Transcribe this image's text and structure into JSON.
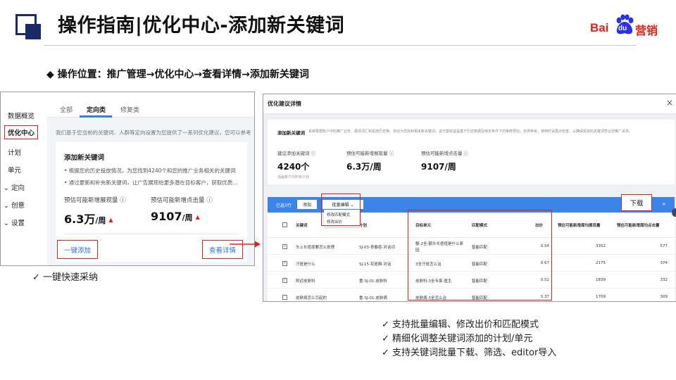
{
  "header": {
    "title": "操作指南|优化中心-添加新关键词",
    "logo": {
      "bai": "Bai",
      "du": "du",
      "yingxiao": "营销"
    }
  },
  "location_line": "◆ 操作位置：推广管理→优化中心→查看详情→添加新关键词",
  "left_panel": {
    "sidebar": [
      "数据概览",
      "优化中心",
      "计划",
      "单元",
      "定向",
      "创意",
      "设置"
    ],
    "sidebar_expand_glyph": "⌄",
    "tabs": [
      "全部",
      "定向类",
      "修复类"
    ],
    "description": "我们基于您当前的关键词、人群等定向设置为您提供了一系列优化建议，您可以参考",
    "card": {
      "title": "添加新关键词",
      "bullets": [
        "• 根据您的历史投放情况，为您找到4240个和您的推广业务相关的关键词",
        "• 通过更新和补充新关键词，让广告展现给更多潜在目标客户，获取优质..."
      ],
      "metric1_label": "预估可能新增展现量 ⓘ",
      "metric1_value": "6.3万",
      "metric1_unit": "/周",
      "metric2_label": "预估可能新增点击量 ⓘ",
      "metric2_value": "9107",
      "metric2_unit": "/周",
      "trend_glyph": "▲",
      "btn_one_click": "一键添加",
      "btn_details": "查看详情"
    }
  },
  "left_check": "✓ 一键快速采纳",
  "right_panel": {
    "title": "优化建议详情",
    "close_glyph": "×",
    "section1": {
      "title": "添加新关键词",
      "desc": "系统根据账户中的推广业务、展现词汇和投放历史等，自动为您找到相关新关键词。该方案收益是基于历史数据及特定条件下的推荐预估，仅供参考。使用时请再次检查，以确保投放的关键词符合您推广诉求。",
      "labels": [
        "建议添加关键词 ⓘ",
        "预估可能新增展现量 ⓘ",
        "预估可能新增点击量 ⓘ"
      ],
      "values": [
        "4240个",
        "6.3万/周",
        "9107/周"
      ],
      "note": "涵盖账户内所有计划"
    },
    "toolbar": {
      "selected": "已选3行",
      "add": "添加",
      "batch_edit": "批量编辑 ⌄",
      "dropdown": [
        "修改匹配模式",
        "修改出价"
      ],
      "download": "下载",
      "close_glyph": "×"
    },
    "columns": [
      "关键词",
      "计划",
      "目标单元",
      "匹配模式",
      "出价",
      "预估可能新增周均展现量",
      "预估可能新增周均点击量"
    ],
    "rows": [
      {
        "checked": true,
        "keyword": "头上长痘痘要怎么处理",
        "plan": "SJ-03-青春痘-对话词",
        "unit_line1": "额-2全-额头长痘痘是什么原",
        "unit_line2": "因",
        "match": "智能匹配",
        "bid": "0.54",
        "impr": "3352",
        "clicks": "577"
      },
      {
        "checked": true,
        "keyword": "汗斑是什么",
        "plan": "SJ-15-花斑癣-对话",
        "unit_line1": "3全汗斑怎么治",
        "unit_line2": "",
        "match": "智能匹配",
        "bid": "0.67",
        "impr": "2175",
        "clicks": "374"
      },
      {
        "checked": true,
        "keyword": "附近皮肤科",
        "plan": "重-SJ-01-皮肤科",
        "unit_line1": "皮肤科-3全专家-医生",
        "unit_line2": "",
        "match": "智能匹配",
        "bid": "0.52",
        "impr": "1839",
        "clicks": "332"
      },
      {
        "checked": false,
        "keyword": "皮肤病怎么引起的",
        "plan": "重-SJ-01-皮肤病",
        "unit_line1": "皮肤病-3全怎么治",
        "unit_line2": "",
        "match": "智能匹配",
        "bid": "0.37",
        "impr": "1709",
        "clicks": "309"
      }
    ]
  },
  "right_checks": [
    "✓ 支持批量编辑、修改出价和匹配模式",
    "✓ 精细化调整关键词添加的计划/单元",
    "✓ 支持关键词批量下载、筛选、editor导入"
  ]
}
